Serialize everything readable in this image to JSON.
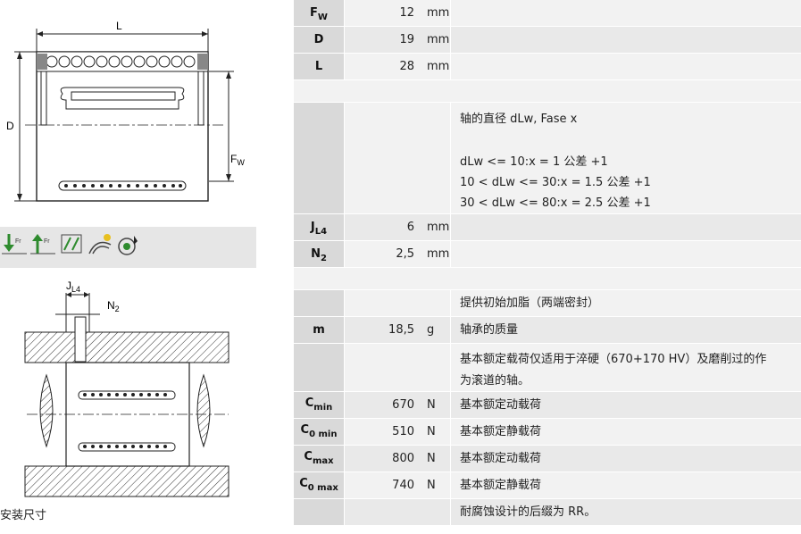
{
  "top_params": [
    {
      "sym_main": "F",
      "sym_sub": "W",
      "value": "12",
      "unit": "mm"
    },
    {
      "sym_main": "D",
      "sym_sub": "",
      "value": "19",
      "unit": "mm"
    },
    {
      "sym_main": "L",
      "sym_sub": "",
      "value": "28",
      "unit": "mm"
    }
  ],
  "fase_block": {
    "title": "轴的直径  dLw, Fase x",
    "lines": [
      "dLw <= 10:x = 1 公差  +1",
      "10 < dLw <= 30:x = 1.5 公差  +1",
      "30 < dLw <= 80:x = 2.5 公差  +1"
    ]
  },
  "mid_params": [
    {
      "sym_main": "J",
      "sym_sub": "L4",
      "value": "6",
      "unit": "mm"
    },
    {
      "sym_main": "N",
      "sym_sub": "2",
      "value": "2,5",
      "unit": "mm"
    }
  ],
  "props": {
    "grease": "提供初始加脂（两端密封）",
    "mass_sym": "m",
    "mass_value": "18,5",
    "mass_unit": "g",
    "mass_text": "轴承的质量",
    "hardness_line1": "基本额定载荷仅适用于淬硬（670+170 HV）及磨削过的作",
    "hardness_line2": "为滚道的轴。",
    "loads": [
      {
        "sym_main": "C",
        "sym_sub": "min",
        "value": "670",
        "unit": "N",
        "text": "基本额定动载荷"
      },
      {
        "sym_main": "C",
        "sym_sub": "0 min",
        "value": "510",
        "unit": "N",
        "text": "基本额定静载荷"
      },
      {
        "sym_main": "C",
        "sym_sub": "max",
        "value": "800",
        "unit": "N",
        "text": "基本额定动载荷"
      },
      {
        "sym_main": "C",
        "sym_sub": "0 max",
        "value": "740",
        "unit": "N",
        "text": "基本额定静载荷"
      }
    ],
    "corrosion": "耐腐蚀设计的后缀为  RR。"
  },
  "drawing1": {
    "label_L": "L",
    "label_D": "D",
    "label_F": "F",
    "label_F_sub": "W"
  },
  "drawing2": {
    "label_J": "J",
    "label_J_sub": "L4",
    "label_N": "N",
    "label_N_sub": "2"
  },
  "icons": [
    "downward-load-icon",
    "upward-load-icon",
    "oscillating-icon",
    "lubrication-icon",
    "seal-icon"
  ],
  "caption": "安装尺寸"
}
